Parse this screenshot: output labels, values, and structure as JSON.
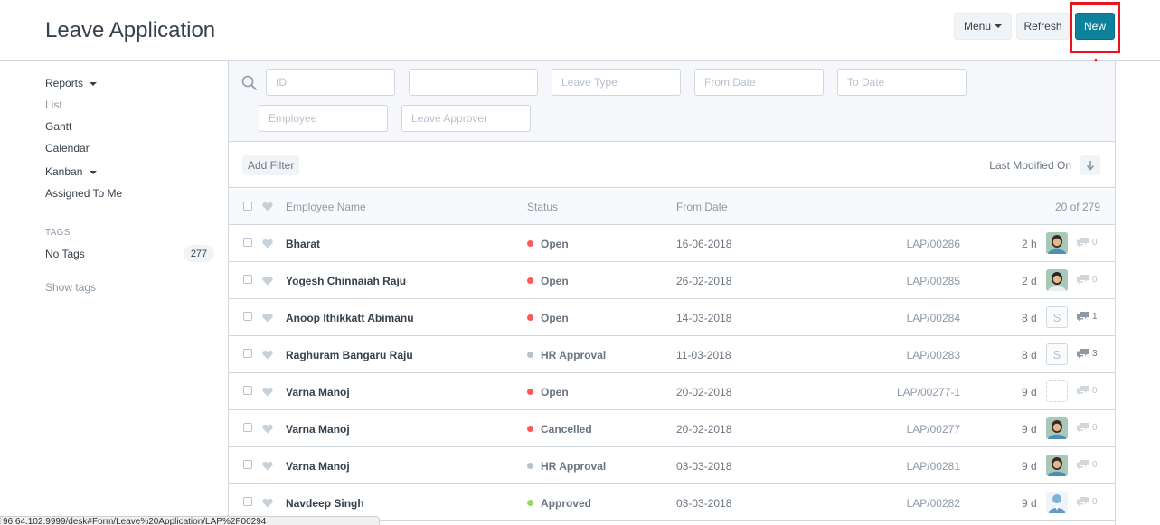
{
  "header": {
    "title": "Leave Application",
    "menu_label": "Menu",
    "refresh_label": "Refresh",
    "new_label": "New"
  },
  "sidebar": {
    "items": [
      {
        "label": "Reports",
        "has_caret": true
      },
      {
        "label": "List",
        "muted": true
      },
      {
        "label": "Gantt"
      },
      {
        "label": "Calendar"
      },
      {
        "label": "Kanban",
        "has_caret": true
      },
      {
        "label": "Assigned To Me"
      }
    ],
    "tags_heading": "TAGS",
    "no_tags_label": "No Tags",
    "no_tags_count": "277",
    "show_tags": "Show tags"
  },
  "filters": {
    "id_placeholder": "ID",
    "blank_placeholder": "",
    "leave_type_placeholder": "Leave Type",
    "from_date_placeholder": "From Date",
    "to_date_placeholder": "To Date",
    "employee_placeholder": "Employee",
    "leave_approver_placeholder": "Leave Approver"
  },
  "toolbar": {
    "add_filter": "Add Filter",
    "sort_label": "Last Modified On"
  },
  "list": {
    "columns": {
      "employee_name": "Employee Name",
      "status": "Status",
      "from_date": "From Date"
    },
    "count": "20 of 279",
    "rows": [
      {
        "employee": "Bharat",
        "status": "Open",
        "status_color": "#ff5858",
        "from_date": "16-06-2018",
        "id": "LAP/00286",
        "modified": "2 h",
        "avatar": "photo-female",
        "comments": "0"
      },
      {
        "employee": "Yogesh Chinnaiah Raju",
        "status": "Open",
        "status_color": "#ff5858",
        "from_date": "26-02-2018",
        "id": "LAP/00285",
        "modified": "2 d",
        "avatar": "photo-male",
        "comments": "0"
      },
      {
        "employee": "Anoop Ithikkatt Abimanu",
        "status": "Open",
        "status_color": "#ff5858",
        "from_date": "14-03-2018",
        "id": "LAP/00284",
        "modified": "8 d",
        "avatar": "letter",
        "avatar_letter": "S",
        "comments": "1"
      },
      {
        "employee": "Raghuram Bangaru Raju",
        "status": "HR Approval",
        "status_color": "#b8c2cc",
        "from_date": "11-03-2018",
        "id": "LAP/00283",
        "modified": "8 d",
        "avatar": "letter",
        "avatar_letter": "S",
        "comments": "3"
      },
      {
        "employee": "Varna Manoj",
        "status": "Open",
        "status_color": "#ff5858",
        "from_date": "20-02-2018",
        "id": "LAP/00277-1",
        "modified": "9 d",
        "avatar": "empty",
        "comments": "0"
      },
      {
        "employee": "Varna Manoj",
        "status": "Cancelled",
        "status_color": "#ff5858",
        "from_date": "20-02-2018",
        "id": "LAP/00277",
        "modified": "9 d",
        "avatar": "photo-female",
        "comments": "0"
      },
      {
        "employee": "Varna Manoj",
        "status": "HR Approval",
        "status_color": "#b8c2cc",
        "from_date": "03-03-2018",
        "id": "LAP/00281",
        "modified": "9 d",
        "avatar": "photo-female",
        "comments": "0"
      },
      {
        "employee": "Navdeep Singh",
        "status": "Approved",
        "status_color": "#98d85b",
        "from_date": "03-03-2018",
        "id": "LAP/00282",
        "modified": "9 d",
        "avatar": "photo-silhouette",
        "comments": "0"
      }
    ]
  },
  "status_bar": {
    "url": "96.64.102.9999/desk#Form/Leave%20Application/LAP%2F00294"
  },
  "colors": {
    "accent": "#0e829c",
    "highlight": "#e8141b"
  }
}
